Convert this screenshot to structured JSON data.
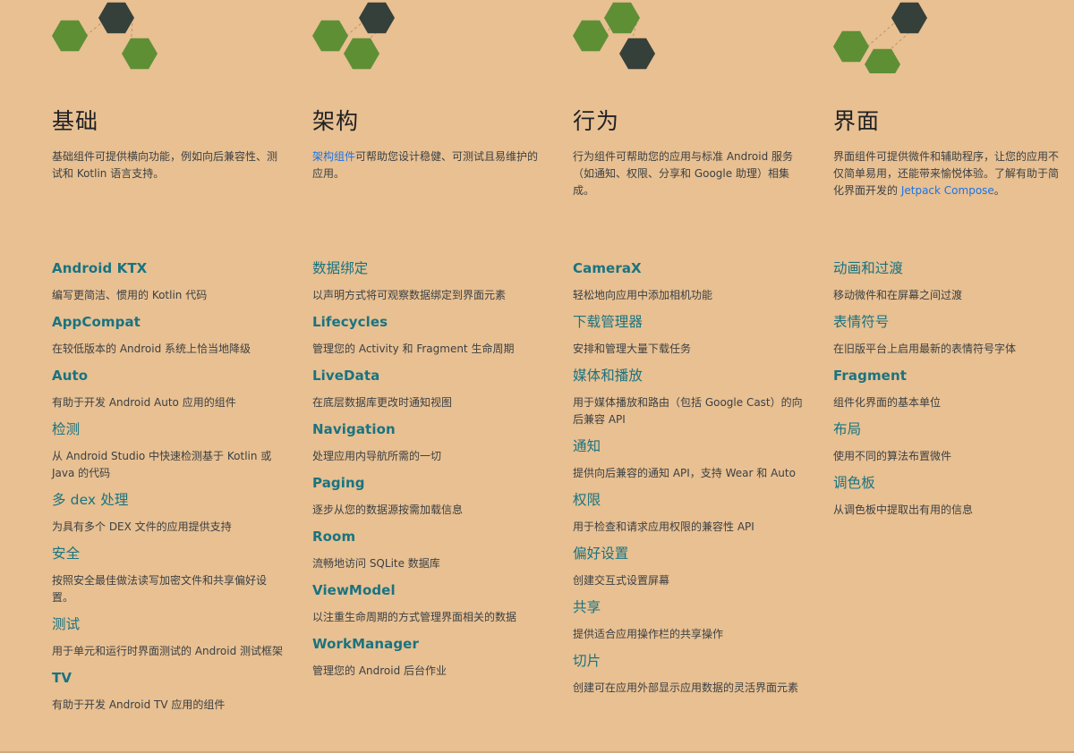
{
  "columns": [
    {
      "title": "基础",
      "desc_parts": [
        {
          "text": "基础组件可提供横向功能，例如向后兼容性、测试和 Kotlin 语言支持。",
          "link": false
        }
      ],
      "hex_scheme": "a",
      "items": [
        {
          "title": "Android KTX",
          "desc": "编写更简洁、惯用的 Kotlin 代码",
          "cjk": false
        },
        {
          "title": "AppCompat",
          "desc": "在较低版本的 Android 系统上恰当地降级",
          "cjk": false
        },
        {
          "title": "Auto",
          "desc": "有助于开发 Android Auto 应用的组件",
          "cjk": false
        },
        {
          "title": "检测",
          "desc": "从 Android Studio 中快速检测基于 Kotlin 或 Java 的代码",
          "cjk": true
        },
        {
          "title": "多 dex 处理",
          "desc": "为具有多个 DEX 文件的应用提供支持",
          "cjk": true
        },
        {
          "title": "安全",
          "desc": "按照安全最佳做法读写加密文件和共享偏好设置。",
          "cjk": true
        },
        {
          "title": "测试",
          "desc": "用于单元和运行时界面测试的 Android 测试框架",
          "cjk": true
        },
        {
          "title": "TV",
          "desc": "有助于开发 Android TV 应用的组件",
          "cjk": false
        }
      ]
    },
    {
      "title": "架构",
      "desc_parts": [
        {
          "text": "架构组件",
          "link": true
        },
        {
          "text": "可帮助您设计稳健、可测试且易维护的应用。",
          "link": false
        }
      ],
      "hex_scheme": "b",
      "items": [
        {
          "title": "数据绑定",
          "desc": "以声明方式将可观察数据绑定到界面元素",
          "cjk": true
        },
        {
          "title": "Lifecycles",
          "desc": "管理您的 Activity 和 Fragment 生命周期",
          "cjk": false
        },
        {
          "title": "LiveData",
          "desc": "在底层数据库更改时通知视图",
          "cjk": false
        },
        {
          "title": "Navigation",
          "desc": "处理应用内导航所需的一切",
          "cjk": false
        },
        {
          "title": "Paging",
          "desc": "逐步从您的数据源按需加载信息",
          "cjk": false
        },
        {
          "title": "Room",
          "desc": "流畅地访问 SQLite 数据库",
          "cjk": false
        },
        {
          "title": "ViewModel",
          "desc": "以注重生命周期的方式管理界面相关的数据",
          "cjk": false
        },
        {
          "title": "WorkManager",
          "desc": "管理您的 Android 后台作业",
          "cjk": false
        }
      ]
    },
    {
      "title": "行为",
      "desc_parts": [
        {
          "text": "行为组件可帮助您的应用与标准 Android 服务（如通知、权限、分享和 Google 助理）相集成。",
          "link": false
        }
      ],
      "hex_scheme": "c",
      "items": [
        {
          "title": "CameraX",
          "desc": "轻松地向应用中添加相机功能",
          "cjk": false
        },
        {
          "title": "下载管理器",
          "desc": "安排和管理大量下载任务",
          "cjk": true
        },
        {
          "title": "媒体和播放",
          "desc": "用于媒体播放和路由（包括 Google Cast）的向后兼容 API",
          "cjk": true
        },
        {
          "title": "通知",
          "desc": "提供向后兼容的通知 API，支持 Wear 和 Auto",
          "cjk": true
        },
        {
          "title": "权限",
          "desc": "用于检查和请求应用权限的兼容性 API",
          "cjk": true
        },
        {
          "title": "偏好设置",
          "desc": "创建交互式设置屏幕",
          "cjk": true
        },
        {
          "title": "共享",
          "desc": "提供适合应用操作栏的共享操作",
          "cjk": true
        },
        {
          "title": "切片",
          "desc": "创建可在应用外部显示应用数据的灵活界面元素",
          "cjk": true
        }
      ]
    },
    {
      "title": "界面",
      "desc_parts": [
        {
          "text": "界面组件可提供微件和辅助程序，让您的应用不仅简单易用，还能带来愉悦体验。了解有助于简化界面开发的 ",
          "link": false
        },
        {
          "text": "Jetpack Compose",
          "link": true
        },
        {
          "text": "。",
          "link": false
        }
      ],
      "hex_scheme": "d",
      "items": [
        {
          "title": "动画和过渡",
          "desc": "移动微件和在屏幕之间过渡",
          "cjk": true
        },
        {
          "title": "表情符号",
          "desc": "在旧版平台上启用最新的表情符号字体",
          "cjk": true
        },
        {
          "title": "Fragment",
          "desc": "组件化界面的基本单位",
          "cjk": false
        },
        {
          "title": "布局",
          "desc": "使用不同的算法布置微件",
          "cjk": true
        },
        {
          "title": "调色板",
          "desc": "从调色板中提取出有用的信息",
          "cjk": true
        }
      ]
    }
  ],
  "colors": {
    "background": "#e8c092",
    "hex_green": "#5f8f35",
    "hex_dark": "#36403a",
    "link": "#1a7380",
    "inline_link": "#1a73e8"
  },
  "icons": [
    "hexagon-cluster-icon"
  ]
}
